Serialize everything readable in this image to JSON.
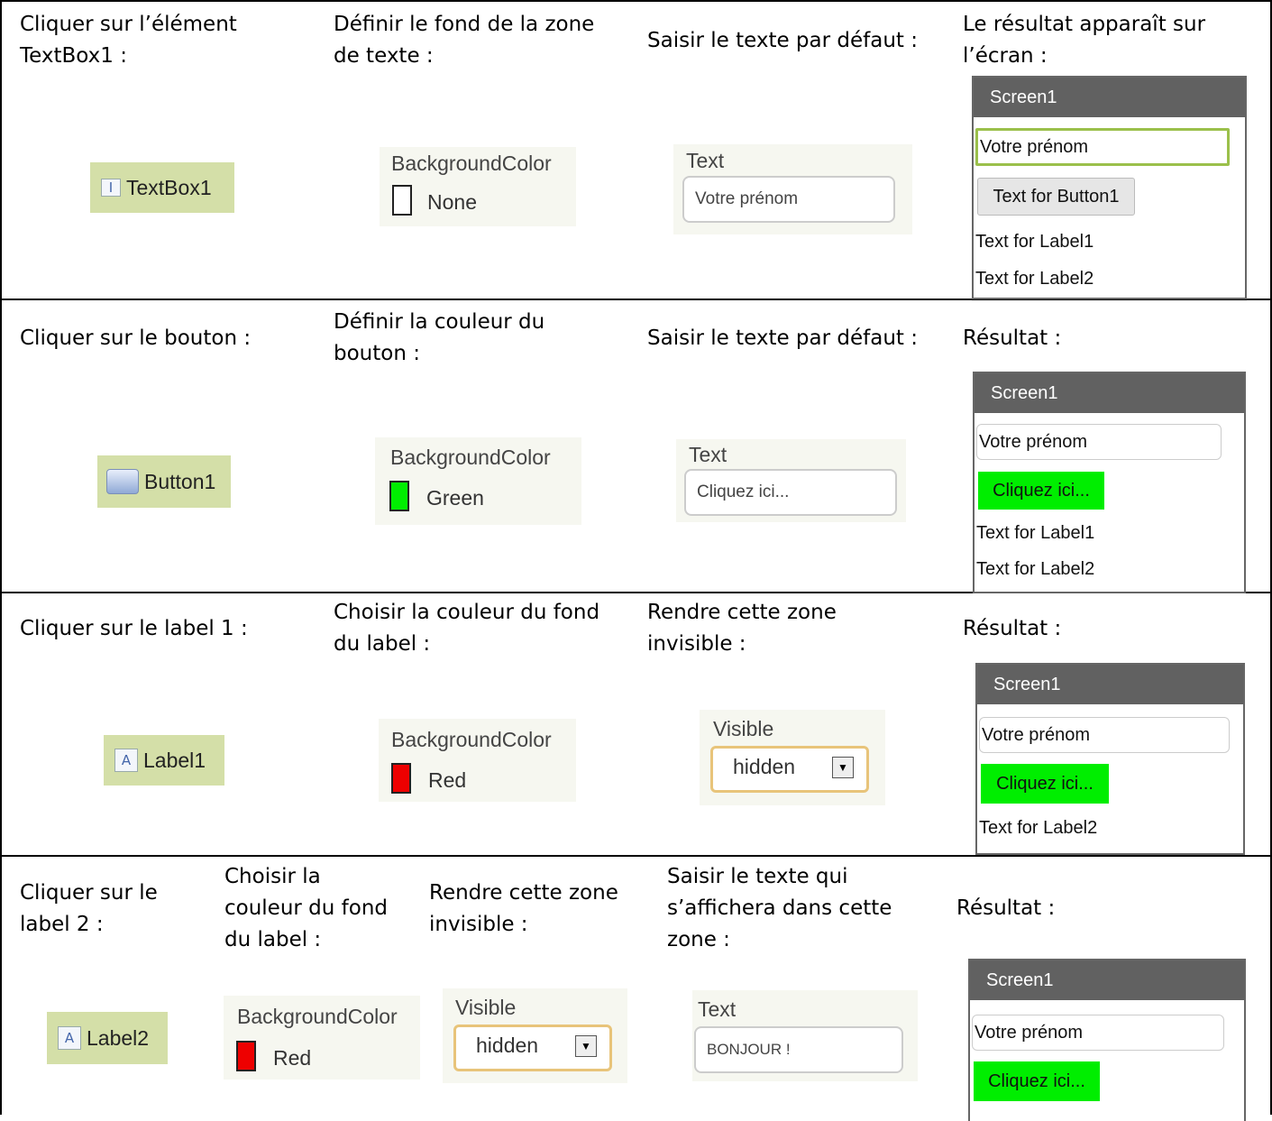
{
  "rows": [
    {
      "instructions": [
        "Cliquer sur l’élément\nTextBox1 :",
        "Définir le fond de la zone\nde texte :",
        "Saisir le texte par défaut :",
        "Le résultat apparaît sur\nl’écran :"
      ],
      "component": {
        "label": "TextBox1",
        "icon": "textbox-icon"
      },
      "background_color": {
        "title": "BackgroundColor",
        "value": "None",
        "color": "#ffffff"
      },
      "text_prop": {
        "title": "Text",
        "value": "Votre prénom"
      }
    },
    {
      "instructions": [
        "Cliquer sur le bouton :",
        "Définir la couleur du\nbouton :",
        "Saisir le texte par défaut :",
        "Résultat :"
      ],
      "component": {
        "label": "Button1",
        "icon": "button-icon"
      },
      "background_color": {
        "title": "BackgroundColor",
        "value": "Green",
        "color": "#00ee00"
      },
      "text_prop": {
        "title": "Text",
        "value": "Cliquez ici..."
      }
    },
    {
      "instructions": [
        "Cliquer sur le label 1 :",
        "Choisir la couleur du fond\ndu label :",
        "Rendre cette zone\ninvisible :",
        "Résultat :"
      ],
      "component": {
        "label": "Label1",
        "icon": "label-icon",
        "glyph": "A"
      },
      "background_color": {
        "title": "BackgroundColor",
        "value": "Red",
        "color": "#ee0000"
      },
      "visible_prop": {
        "title": "Visible",
        "value": "hidden"
      }
    },
    {
      "instructions": [
        "Cliquer sur le\nlabel 2 :",
        "Choisir la\ncouleur du fond\ndu label :",
        "Rendre cette zone\ninvisible :",
        "Saisir le texte qui\ns’affichera dans cette\nzone :",
        "Résultat :"
      ],
      "component": {
        "label": "Label2",
        "icon": "label-icon",
        "glyph": "A"
      },
      "background_color": {
        "title": "BackgroundColor",
        "value": "Red",
        "color": "#ee0000"
      },
      "visible_prop": {
        "title": "Visible",
        "value": "hidden"
      },
      "text_prop": {
        "title": "Text",
        "value": "BONJOUR !"
      }
    }
  ],
  "screens": [
    {
      "title": "Screen1",
      "textbox": "Votre prénom",
      "button": "Text for Button1",
      "label1": "Text for Label1",
      "label2": "Text for Label2"
    },
    {
      "title": "Screen1",
      "textbox": "Votre prénom",
      "button": "Cliquez ici...",
      "label1": "Text for Label1",
      "label2": "Text for Label2"
    },
    {
      "title": "Screen1",
      "textbox": "Votre prénom",
      "button": "Cliquez ici...",
      "label2": "Text for Label2"
    },
    {
      "title": "Screen1",
      "textbox": "Votre prénom",
      "button": "Cliquez ici..."
    }
  ],
  "colors": {
    "chip_bg": "#d4dfa8",
    "panel_bg": "#f6f7f0",
    "screen_bar": "#616161",
    "focus_border": "#9bc04b",
    "select_border": "#e8c47a"
  }
}
